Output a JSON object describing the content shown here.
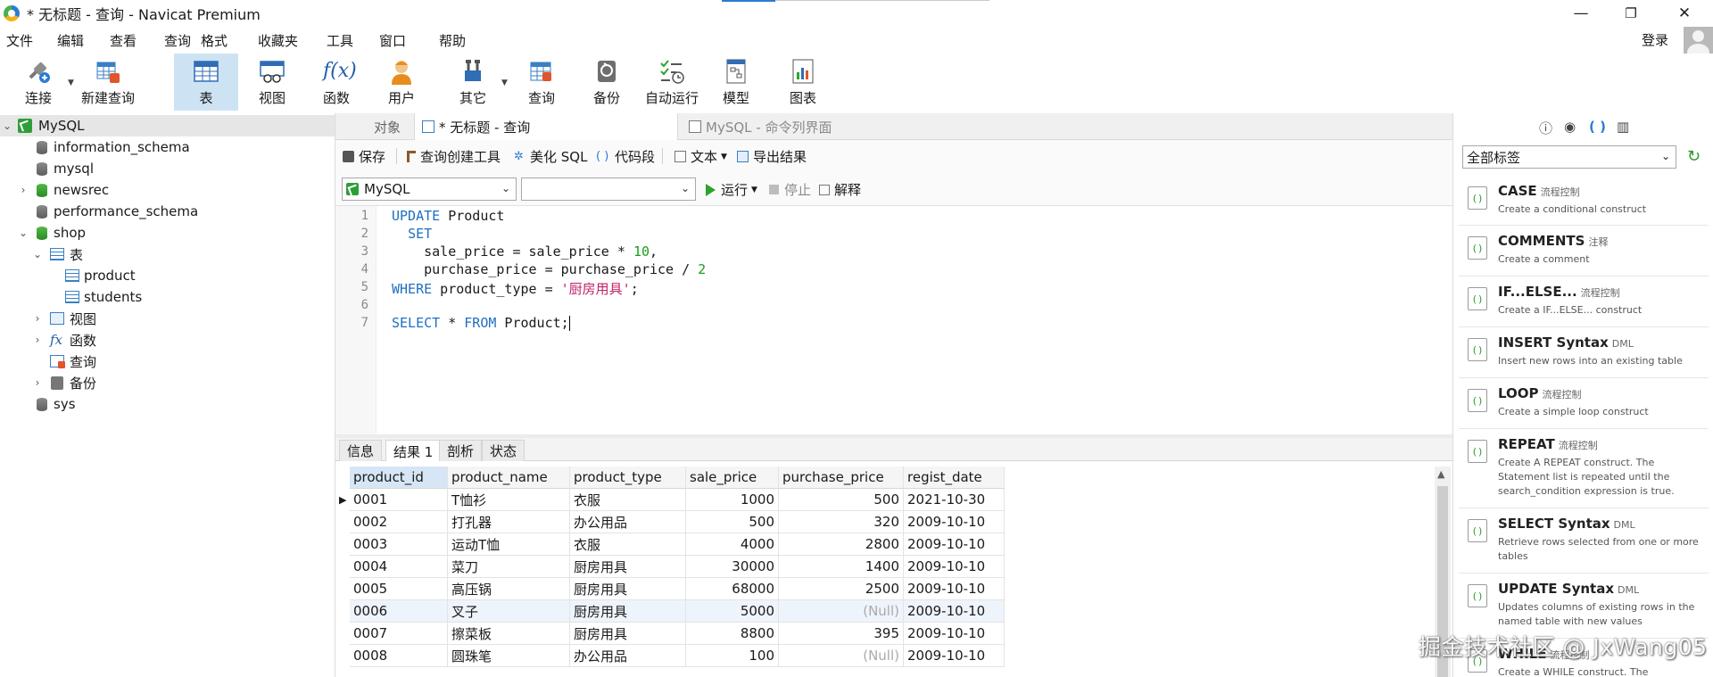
{
  "window": {
    "title": "* 无标题 - 查询 - Navicat Premium",
    "minimize": "—",
    "restore": "❐",
    "close": "✕"
  },
  "menu": {
    "items": [
      "文件",
      "编辑",
      "查看",
      "查询",
      "格式",
      "收藏夹",
      "工具",
      "窗口",
      "帮助"
    ],
    "login": "登录"
  },
  "toolbar": {
    "buttons": [
      "连接",
      "新建查询",
      "表",
      "视图",
      "函数",
      "用户",
      "其它",
      "查询",
      "备份",
      "自动运行",
      "模型",
      "图表"
    ],
    "active": "表"
  },
  "tree": {
    "connection": "MySQL",
    "databases": [
      "information_schema",
      "mysql",
      "newsrec",
      "performance_schema",
      "shop",
      "sys"
    ],
    "shop_children": [
      "表",
      "视图",
      "函数",
      "查询",
      "备份"
    ],
    "tables": [
      "product",
      "students"
    ]
  },
  "tabs": {
    "objects": "对象",
    "query": "* 无标题 - 查询",
    "terminal": "MySQL - 命令列界面"
  },
  "query_toolbar": {
    "save": "保存",
    "builder": "查询创建工具",
    "beautify": "美化 SQL",
    "snippet": "代码段",
    "text": "文本",
    "export": "导出结果",
    "connection": "MySQL",
    "database": "",
    "run": "运行",
    "stop": "停止",
    "explain": "解释"
  },
  "editor": {
    "line_numbers": [
      "1",
      "2",
      "3",
      "4",
      "5",
      "6",
      "7"
    ]
  },
  "result_tabs": [
    "信息",
    "结果 1",
    "剖析",
    "状态"
  ],
  "result": {
    "columns": [
      "product_id",
      "product_name",
      "product_type",
      "sale_price",
      "purchase_price",
      "regist_date"
    ],
    "rows": [
      [
        "0001",
        "T恤衫",
        "衣服",
        "1000",
        "500",
        "2021-10-30"
      ],
      [
        "0002",
        "打孔器",
        "办公用品",
        "500",
        "320",
        "2009-10-10"
      ],
      [
        "0003",
        "运动T恤",
        "衣服",
        "4000",
        "2800",
        "2009-10-10"
      ],
      [
        "0004",
        "菜刀",
        "厨房用具",
        "30000",
        "1400",
        "2009-10-10"
      ],
      [
        "0005",
        "高压锅",
        "厨房用具",
        "68000",
        "2500",
        "2009-10-10"
      ],
      [
        "0006",
        "叉子",
        "厨房用具",
        "5000",
        "(Null)",
        "2009-10-10"
      ],
      [
        "0007",
        "擦菜板",
        "厨房用具",
        "8800",
        "395",
        "2009-10-10"
      ],
      [
        "0008",
        "圆珠笔",
        "办公用品",
        "100",
        "(Null)",
        "2009-10-10"
      ]
    ]
  },
  "right_panel": {
    "filter": "全部标签",
    "snippets": [
      {
        "title": "CASE",
        "tag": "流程控制",
        "desc": "Create a conditional construct"
      },
      {
        "title": "COMMENTS",
        "tag": "注释",
        "desc": "Create a comment"
      },
      {
        "title": "IF...ELSE...",
        "tag": "流程控制",
        "desc": "Create a IF...ELSE... construct"
      },
      {
        "title": "INSERT Syntax",
        "tag": "DML",
        "desc": "Insert new rows into an existing table"
      },
      {
        "title": "LOOP",
        "tag": "流程控制",
        "desc": "Create a simple loop construct"
      },
      {
        "title": "REPEAT",
        "tag": "流程控制",
        "desc": "Create A REPEAT construct. The Statement list is repeated until the search_condition expression is true."
      },
      {
        "title": "SELECT Syntax",
        "tag": "DML",
        "desc": "Retrieve rows selected from one or more tables"
      },
      {
        "title": "UPDATE Syntax",
        "tag": "DML",
        "desc": "Updates columns of existing rows in the named table with new values"
      },
      {
        "title": "WHILE",
        "tag": "流程控制",
        "desc": "Create a WHILE construct. The statement"
      }
    ]
  },
  "watermark": "掘金技术社区 @ JxWang05"
}
